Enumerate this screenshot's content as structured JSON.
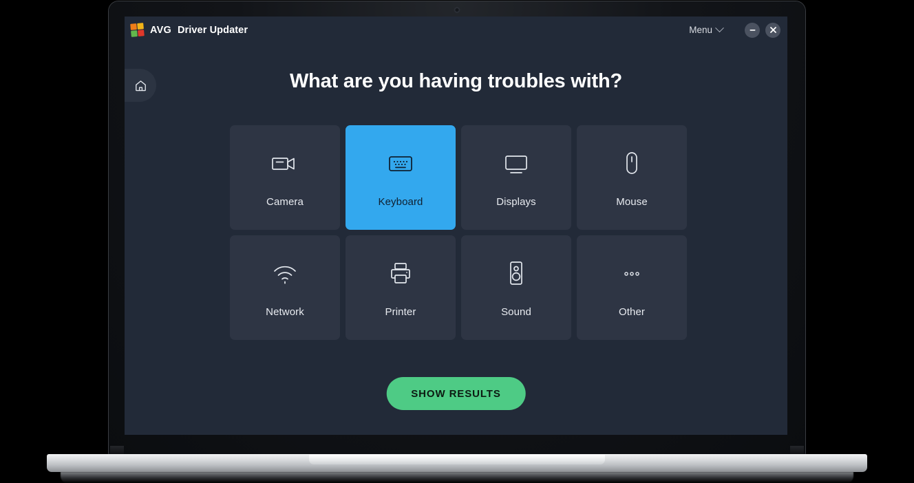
{
  "app": {
    "brand": "AVG",
    "title": "Driver Updater",
    "logo_icon": "avg-logo-icon"
  },
  "titlebar": {
    "menu_label": "Menu",
    "menu_chevron_icon": "chevron-down-icon",
    "minimize_icon": "minimize-icon",
    "close_icon": "close-icon"
  },
  "navigation": {
    "home_icon": "home-icon"
  },
  "main": {
    "heading": "What are you having troubles with?",
    "tiles": [
      {
        "label": "Camera",
        "icon": "video-camera-icon",
        "selected": false
      },
      {
        "label": "Keyboard",
        "icon": "keyboard-icon",
        "selected": true
      },
      {
        "label": "Displays",
        "icon": "monitor-icon",
        "selected": false
      },
      {
        "label": "Mouse",
        "icon": "mouse-icon",
        "selected": false
      },
      {
        "label": "Network",
        "icon": "wifi-icon",
        "selected": false
      },
      {
        "label": "Printer",
        "icon": "printer-icon",
        "selected": false
      },
      {
        "label": "Sound",
        "icon": "speaker-icon",
        "selected": false
      },
      {
        "label": "Other",
        "icon": "ellipsis-icon",
        "selected": false
      }
    ],
    "cta_label": "SHOW RESULTS"
  },
  "colors": {
    "background": "#000000",
    "app_background": "#222a38",
    "tile": "#2e3544",
    "tile_selected": "#33a8ee",
    "cta": "#4ecb85",
    "text": "#e8ebf0"
  }
}
